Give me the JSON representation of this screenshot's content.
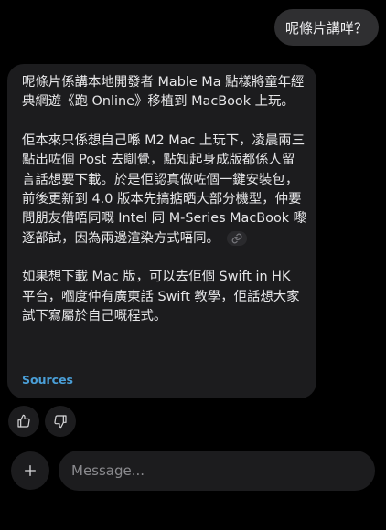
{
  "user_message": "呢條片講咩？",
  "assistant_message": {
    "paragraphs": [
      "呢條片係講本地開發者 Mable Ma 點樣將童年經典網遊《跑 Online》移植到 MacBook 上玩。",
      "佢本來只係想自己喺 M2 Mac 上玩下，凌晨兩三點出咗個 Post 去瞓覺，點知起身成版都係人留言話想要下載。於是佢認真做咗個一鍵安裝包，前後更新到 4.0 版本先搞掂晒大部分機型，仲要問朋友借唔同嘅 Intel 同 M-Series MacBook 嚟逐部試，因為兩邊渲染方式唔同。",
      "如果想下載 Mac 版，可以去佢個 Swift in HK 平台，嗰度仲有廣東話 Swift 教學，佢話想大家試下寫屬於自己嘅程式。"
    ],
    "sources_label": "Sources"
  },
  "composer": {
    "placeholder": "Message..."
  },
  "icons": {
    "link": "link-icon",
    "thumbs_up": "thumbs-up-icon",
    "thumbs_down": "thumbs-down-icon",
    "plus": "plus-icon"
  },
  "colors": {
    "background": "#000000",
    "bubble": "#1c1c1e",
    "user_bubble": "#2f2f31",
    "sources_link": "#4a9fd8"
  }
}
